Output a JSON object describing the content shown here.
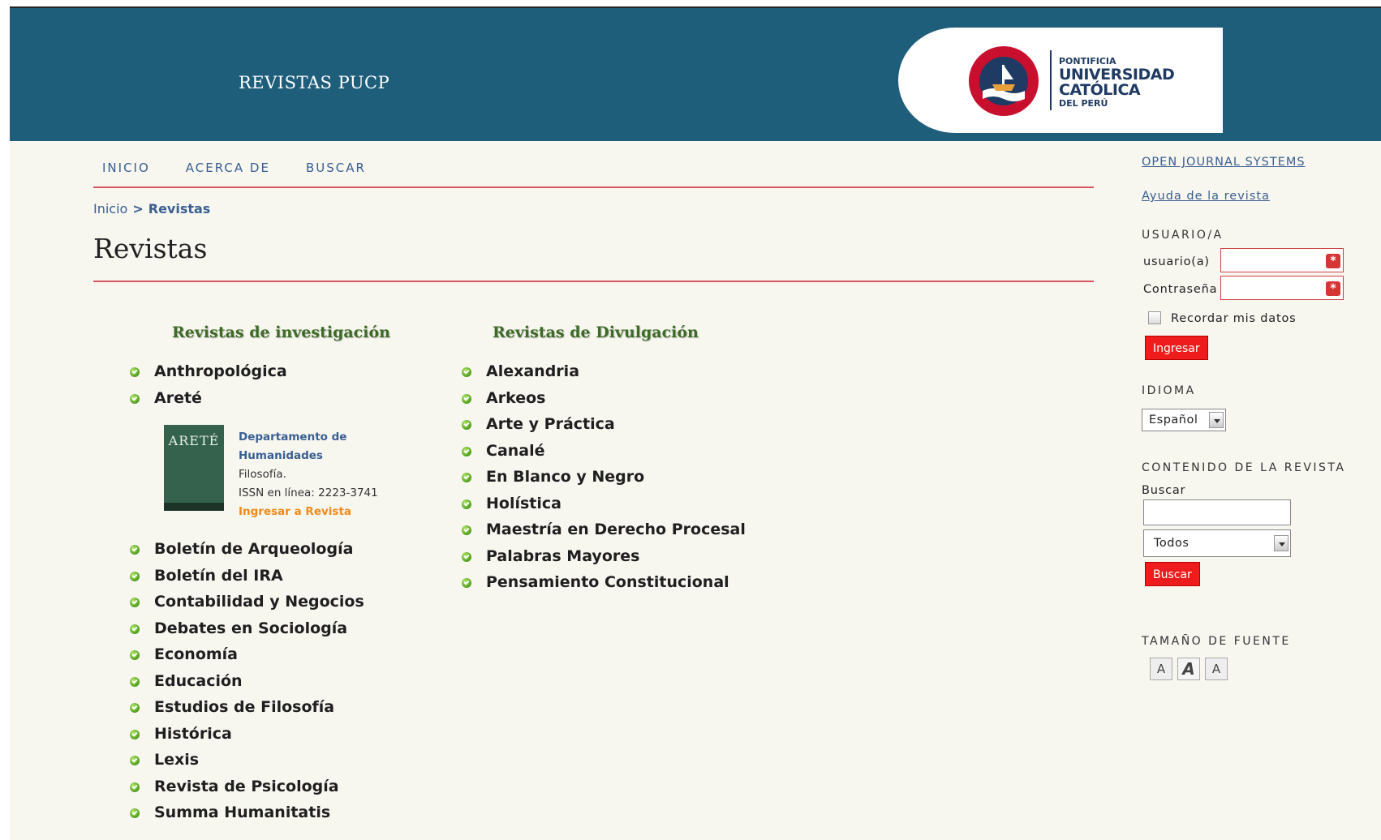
{
  "header": {
    "site_title": "REVISTAS PUCP",
    "logo": {
      "line1": "PONTIFICIA",
      "line2": "UNIVERSIDAD",
      "line3": "CATÓLICA",
      "line4": "DEL PERÚ"
    }
  },
  "nav": {
    "items": [
      "INICIO",
      "ACERCA DE",
      "BUSCAR"
    ]
  },
  "breadcrumb": {
    "home": "Inicio",
    "separator": ">",
    "current": "Revistas"
  },
  "page_title": "Revistas",
  "columns": {
    "investigacion": {
      "heading": "Revistas de investigación",
      "items_before": [
        "Anthropológica",
        "Areté"
      ],
      "expanded": {
        "cover_text": "ARETÉ",
        "department": "Departamento de Humanidades",
        "subject": "Filosofía.",
        "issn": "ISSN en línea: 2223-3741",
        "enter_link": "Ingresar a Revista"
      },
      "items_after": [
        "Boletín de Arqueología",
        "Boletín del IRA",
        "Contabilidad y Negocios",
        "Debates en Sociología",
        "Economía",
        "Educación",
        "Estudios de Filosofía",
        "Histórica",
        "Lexis",
        "Revista de Psicología",
        "Summa Humanitatis"
      ]
    },
    "divulgacion": {
      "heading": "Revistas de Divulgación",
      "items": [
        "Alexandria",
        "Arkeos",
        "Arte y Práctica",
        "Canalé",
        "En Blanco y Negro",
        "Holística",
        "Maestría en Derecho Procesal",
        "Palabras Mayores",
        "Pensamiento Constitucional"
      ]
    }
  },
  "sidebar": {
    "ojs_link": "OPEN JOURNAL SYSTEMS",
    "help_link": "Ayuda de la revista",
    "user": {
      "heading": "USUARIO/A",
      "username_label": "usuario(a)",
      "password_label": "Contraseña",
      "remember_label": "Recordar mis datos",
      "login_button": "Ingresar"
    },
    "language": {
      "heading": "IDIOMA",
      "selected": "Español"
    },
    "content": {
      "heading": "CONTENIDO DE LA REVISTA",
      "search_label": "Buscar",
      "scope_selected": "Todos",
      "search_button": "Buscar"
    },
    "font_size": {
      "heading": "TAMAÑO DE FUENTE",
      "small": "A",
      "medium": "A",
      "large": "A"
    }
  }
}
